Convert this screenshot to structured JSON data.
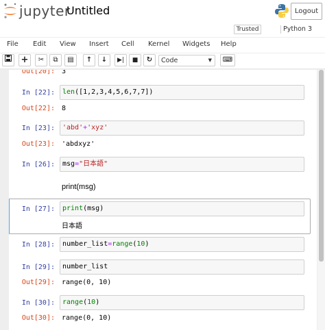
{
  "header": {
    "logo_text": "jupyter",
    "notebook_title": "Untitled",
    "logout_label": "Logout"
  },
  "status": {
    "trusted_label": "Trusted",
    "kernel_name": "Python 3"
  },
  "menu": [
    "File",
    "Edit",
    "View",
    "Insert",
    "Cell",
    "Kernel",
    "Widgets",
    "Help"
  ],
  "toolbar": {
    "icons": [
      "save-icon",
      "plus-icon",
      "cut-icon",
      "copy-icon",
      "paste-icon",
      "arrow-up-icon",
      "arrow-down-icon",
      "run-icon",
      "stop-icon",
      "restart-icon",
      "keyboard-icon"
    ],
    "cell_type": "Code"
  },
  "cells": [
    {
      "out_prompt": "Out[20]:",
      "output": "3"
    },
    {
      "in_prompt": "In [22]:",
      "code_prefix": "len",
      "code_rest": "([1,2,3,4,5,6,7,7])",
      "out_prompt": "Out[22]:",
      "output": "8"
    },
    {
      "in_prompt": "In [23]:",
      "code_s1": "'abd'",
      "code_op": "+",
      "code_s2": "'xyz'",
      "out_prompt": "Out[23]:",
      "output": "'abdxyz'"
    },
    {
      "in_prompt": "In [26]:",
      "code_var": "msg",
      "code_op": "=",
      "code_str": "\"日本語\""
    },
    {
      "markdown": "print(msg)"
    },
    {
      "in_prompt": "In [27]:",
      "code_fn": "print",
      "code_rest": "(msg)",
      "output": "日本語"
    },
    {
      "in_prompt": "In [28]:",
      "code_var": "number_list",
      "code_op": "=",
      "code_fn": "range",
      "code_num": "10"
    },
    {
      "in_prompt": "In [29]:",
      "code": "number_list",
      "out_prompt": "Out[29]:",
      "output": "range(0, 10)"
    },
    {
      "in_prompt": "In [30]:",
      "code_fn": "range",
      "code_num": "10",
      "out_prompt": "Out[30]:",
      "output": "range(0, 10)"
    }
  ]
}
